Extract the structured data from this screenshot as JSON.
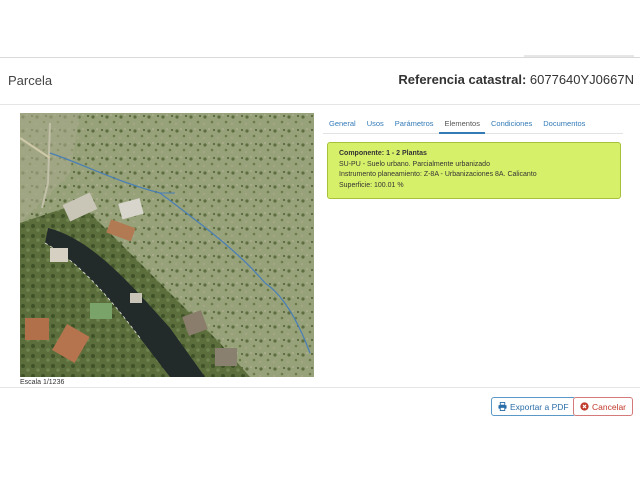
{
  "header": {
    "title": "Parcela",
    "ref_label": "Referencia catastral:",
    "ref_value": "6077640YJ0667N"
  },
  "map": {
    "scale_label": "Escala 1/1236",
    "boundary_color": "#4a7fb5"
  },
  "tabs": [
    {
      "label": "General",
      "active": false
    },
    {
      "label": "Usos",
      "active": false
    },
    {
      "label": "Parámetros",
      "active": false
    },
    {
      "label": "Elementos",
      "active": true
    },
    {
      "label": "Condiciones",
      "active": false
    },
    {
      "label": "Documentos",
      "active": false
    }
  ],
  "component": {
    "title_label": "Componente:",
    "title_value": "1 - 2 Plantas",
    "line1": "SU-PU - Suelo urbano. Parcialmente urbanizado",
    "line2": "Instrumento planeamiento: Z-8A - Urbanizaciones 8A. Calicanto",
    "line3": "Superficie: 100.01 %",
    "background": "#d7f06a"
  },
  "footer": {
    "pdf_label": "Exportar a PDF",
    "pdf_icon": "print-icon",
    "cancel_label": "Cancelar",
    "cancel_icon": "close-circle-icon"
  }
}
